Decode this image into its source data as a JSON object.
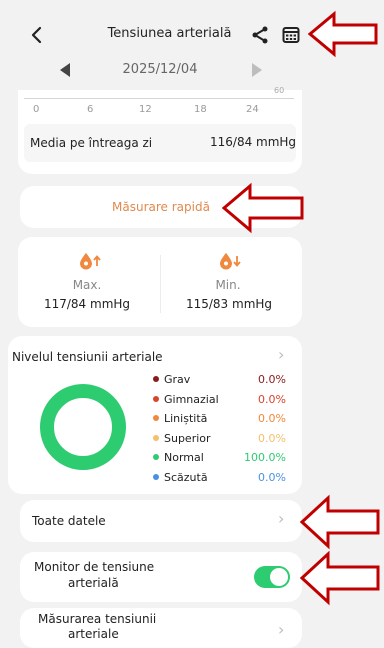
{
  "header": {
    "title": "Tensiunea arterială",
    "date": "2025/12/04"
  },
  "chart_axis": {
    "ticks": [
      "0",
      "6",
      "12",
      "18",
      "24"
    ],
    "corner_label": "60"
  },
  "daily_average": {
    "label": "Media pe întreaga zi",
    "value": "116/84 mmHg"
  },
  "quick_measure": {
    "label": "Măsurare rapidă"
  },
  "extremes": {
    "max_label": "Max.",
    "max_value": "117/84 mmHg",
    "min_label": "Min.",
    "min_value": "115/83 mmHg",
    "max_color": "#f0883e",
    "min_color": "#f0883e"
  },
  "level": {
    "title": "Nivelul tensiunii arteriale",
    "ring_color": "#2ecc71",
    "legend": [
      {
        "label": "Grav",
        "value": "0.0%",
        "color": "#8b1a1a",
        "value_color": "#8b1a1a"
      },
      {
        "label": "Gimnazial",
        "value": "0.0%",
        "color": "#d9442b",
        "value_color": "#d9442b"
      },
      {
        "label": "Liniștită",
        "value": "0.0%",
        "color": "#f0883e",
        "value_color": "#f0883e"
      },
      {
        "label": "Superior",
        "value": "0.0%",
        "color": "#f3c06b",
        "value_color": "#f3c06b"
      },
      {
        "label": "Normal",
        "value": "100.0%",
        "color": "#2ecc71",
        "value_color": "#2ecc71"
      },
      {
        "label": "Scăzută",
        "value": "0.0%",
        "color": "#4a90e2",
        "value_color": "#4a90e2"
      }
    ]
  },
  "all_data": {
    "label": "Toate datele"
  },
  "monitor": {
    "label_line1": "Monitor de tensiune",
    "label_line2": "arterială",
    "enabled": true,
    "toggle_color": "#2ecc71"
  },
  "measurement": {
    "label_line1": "Măsurarea tensiunii",
    "label_line2": "arteriale"
  },
  "annotation_color": "#c00000"
}
